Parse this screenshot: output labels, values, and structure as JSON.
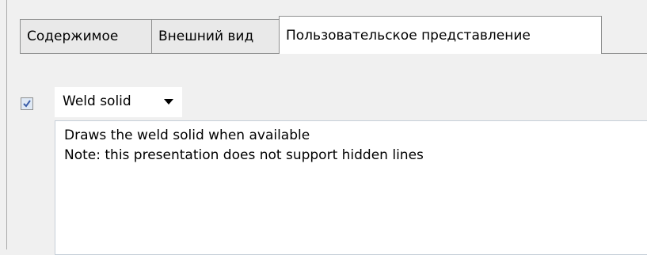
{
  "tabs": [
    {
      "label": "Содержимое",
      "active": false
    },
    {
      "label": "Внешний вид",
      "active": false
    },
    {
      "label": "Пользовательское представление",
      "active": true
    }
  ],
  "presentation": {
    "enabled": true,
    "selected_value": "Weld solid"
  },
  "description": {
    "line1": "Draws the weld solid when available",
    "line2": "Note: this presentation does not support hidden lines"
  }
}
